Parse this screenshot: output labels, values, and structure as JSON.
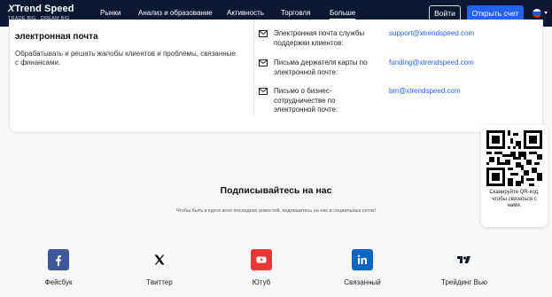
{
  "header": {
    "logo": {
      "title": "Trend Speed",
      "tagline": "TRADE BIG · DREAM BIG"
    },
    "nav": [
      "Рынки",
      "Анализ и образование",
      "Активность",
      "Торговля",
      "Больше"
    ],
    "active_nav": "Больше",
    "login_label": "Войти",
    "open_account_label": "Открыть счет",
    "language_flag": "ru-flag-icon"
  },
  "email_section": {
    "title": "электронная почта",
    "description": "Обрабатывать и решать жалобы клиентов и проблемы, связанные с финансами.",
    "contacts": [
      {
        "label": "Электронная почта службы поддержки клиентов:",
        "email": "support@xtrendspeed.com",
        "icon": "mail-icon"
      },
      {
        "label": "Письма держателя карты по электронной почте:",
        "email": "funding@xtrendspeed.com",
        "icon": "mail-icon"
      },
      {
        "label": "Письмо о бизнес-сотрудничестве по электронной почте:",
        "email": "bm@xtrendspeed.com",
        "icon": "mail-icon"
      }
    ]
  },
  "subscribe": {
    "title": "Подписывайтесь на нас",
    "description": "Чтобы быть в курсе всех последних новостей, подпишитесь на нас в социальных сетях!"
  },
  "qr": {
    "text": "Сканируйте QR-код, чтобы связаться с нами."
  },
  "socials": [
    {
      "label": "Фейсбук",
      "icon": "facebook-icon",
      "color": "#3b5998"
    },
    {
      "label": "Твиттер",
      "icon": "x-twitter-icon",
      "color": "#000000"
    },
    {
      "label": "Ютуб",
      "icon": "youtube-icon",
      "color": "#e53935"
    },
    {
      "label": "Связанный",
      "icon": "linkedin-icon",
      "color": "#0a66c2"
    },
    {
      "label": "Трейдинг Вью",
      "icon": "tradingview-icon",
      "color": "#131722"
    }
  ],
  "colors": {
    "nav_bg": "#0b1733",
    "accent": "#2563eb",
    "link": "#2563eb"
  }
}
